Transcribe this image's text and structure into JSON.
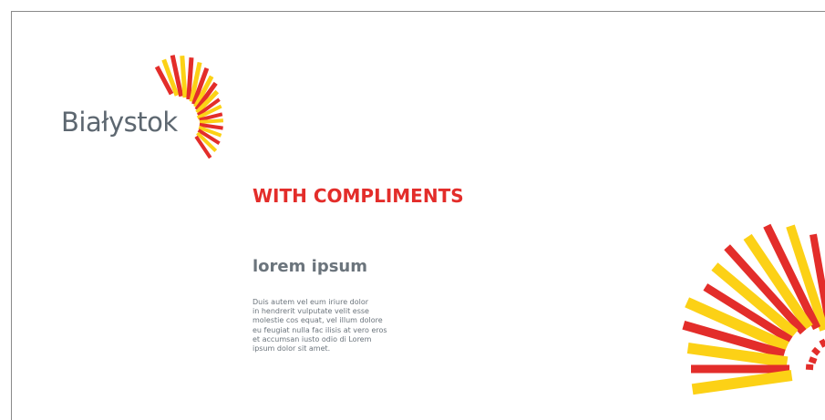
{
  "logo": {
    "wordmark": "Białystok",
    "colors": {
      "red": "#e32d2a",
      "yellow": "#fcd116",
      "gray": "#5d6770"
    }
  },
  "headline": "WITH COMPLIMENTS",
  "subheading": "lorem ipsum",
  "body_lines": [
    "Duis autem vel eum iriure dolor",
    "in hendrerit vulputate velit esse",
    "molestie cos equat, vel illum dolore",
    "eu feugiat nulla fac ilisis at vero eros",
    "et accumsan iusto odio di Lorem",
    "ipsum dolor sit amet."
  ],
  "colors": {
    "headline": "#e32d2a",
    "text": "#6b747c",
    "frame": "#8a8a8a"
  }
}
